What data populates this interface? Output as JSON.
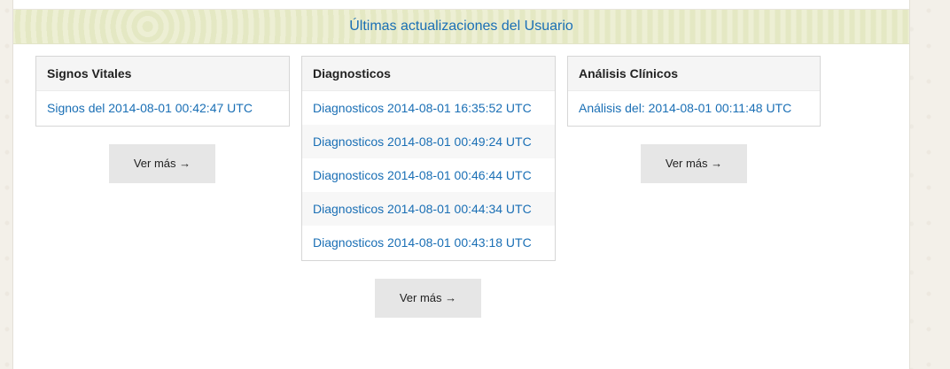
{
  "header": {
    "title": "Últimas actualizaciones del Usuario"
  },
  "signos": {
    "title": "Signos Vitales",
    "items": [
      "Signos del 2014-08-01 00:42:47 UTC"
    ],
    "more_label": "Ver más →"
  },
  "diagnosticos": {
    "title": "Diagnosticos",
    "items": [
      "Diagnosticos 2014-08-01 16:35:52 UTC",
      "Diagnosticos 2014-08-01 00:49:24 UTC",
      "Diagnosticos 2014-08-01 00:46:44 UTC",
      "Diagnosticos 2014-08-01 00:44:34 UTC",
      "Diagnosticos 2014-08-01 00:43:18 UTC"
    ],
    "more_label": "Ver más →"
  },
  "analisis": {
    "title": "Análisis Clínicos",
    "items": [
      "Análisis del: 2014-08-01 00:11:48 UTC"
    ],
    "more_label": "Ver más →"
  }
}
